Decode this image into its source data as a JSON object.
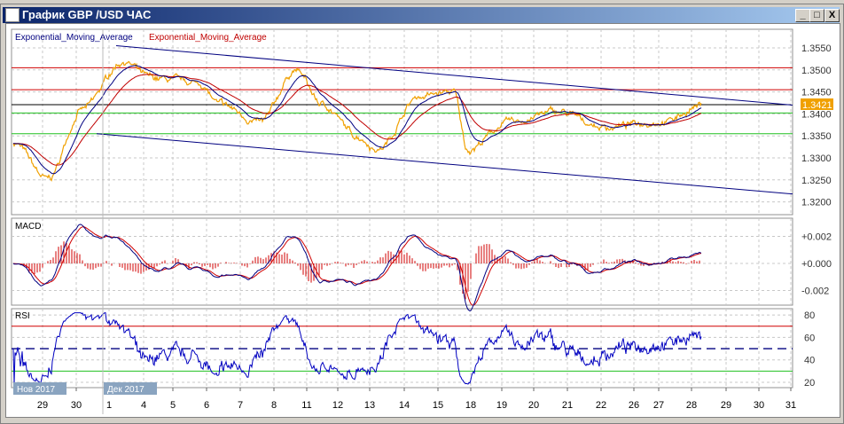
{
  "window": {
    "title": "График GBP /USD  ЧАС",
    "minimize": "_",
    "maximize": "□",
    "close": "X"
  },
  "legend": {
    "ema_fast": "Exponential_Moving_Average",
    "ema_slow": "Exponential_Moving_Average"
  },
  "colors": {
    "price": "#f0a000",
    "ema_fast": "#000080",
    "ema_slow": "#c00000",
    "resistance": "#d00000",
    "support": "#20c020",
    "current": "#000000",
    "channel": "#000080",
    "current_label_bg": "#f0a000"
  },
  "price_axis": {
    "ticks": [
      "1.3550",
      "1.3500",
      "1.3450",
      "1.3400",
      "1.3350",
      "1.3300",
      "1.3250",
      "1.3200"
    ],
    "current": "1.3421"
  },
  "levels": {
    "resistance": [
      1.3505,
      1.3455
    ],
    "support": [
      1.3402,
      1.3355
    ],
    "current": 1.3421
  },
  "channel": {
    "upper": [
      1.3555,
      1.342
    ],
    "lower": [
      1.3355,
      1.3218
    ]
  },
  "price_keypoints": [
    [
      0,
      1.3335
    ],
    [
      0.05,
      1.325
    ],
    [
      0.1,
      1.341
    ],
    [
      0.16,
      1.352
    ],
    [
      0.2,
      1.348
    ],
    [
      0.27,
      1.347
    ],
    [
      0.3,
      1.342
    ],
    [
      0.36,
      1.338
    ],
    [
      0.41,
      1.35
    ],
    [
      0.45,
      1.342
    ],
    [
      0.5,
      1.335
    ],
    [
      0.53,
      1.332
    ],
    [
      0.59,
      1.344
    ],
    [
      0.64,
      1.345
    ],
    [
      0.66,
      1.332
    ],
    [
      0.72,
      1.338
    ],
    [
      0.79,
      1.3405
    ],
    [
      0.86,
      1.337
    ],
    [
      0.95,
      1.3385
    ],
    [
      1,
      1.342
    ]
  ],
  "macd": {
    "label": "MACD",
    "ticks": [
      "+0.002",
      "+0.000",
      "-0.002"
    ]
  },
  "rsi": {
    "label": "RSI",
    "ticks": [
      "80",
      "60",
      "40",
      "20"
    ],
    "levels": [
      70,
      50,
      30
    ]
  },
  "time_axis": {
    "months": [
      "Нов 2017",
      "Дек 2017"
    ],
    "days": [
      "29",
      "30",
      "1",
      "4",
      "5",
      "6",
      "7",
      "8",
      "11",
      "12",
      "13",
      "14",
      "15",
      "18",
      "19",
      "20",
      "21",
      "22",
      "26",
      "27",
      "28",
      "29",
      "30",
      "31"
    ]
  }
}
